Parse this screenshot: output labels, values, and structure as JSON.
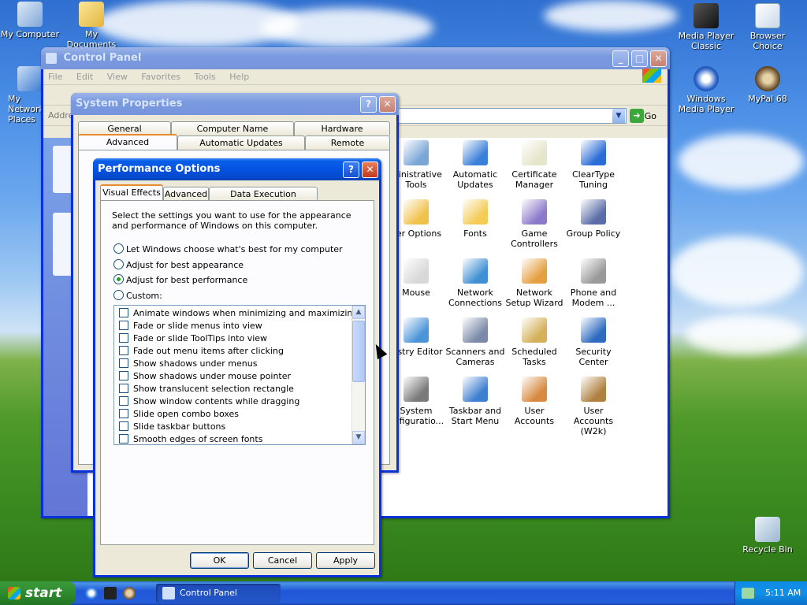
{
  "desktop": {
    "icons": [
      {
        "label": "My Computer"
      },
      {
        "label": "My Documents"
      },
      {
        "label": "My Network Places"
      },
      {
        "label": "Media Player Classic"
      },
      {
        "label": "Browser Choice"
      },
      {
        "label": "Windows Media Player"
      },
      {
        "label": "MyPal 68"
      },
      {
        "label": "Recycle Bin"
      }
    ]
  },
  "control_panel": {
    "title": "Control Panel",
    "menu": [
      "File",
      "Edit",
      "View",
      "Favorites",
      "Tools",
      "Help"
    ],
    "address_label": "Addre",
    "go_label": "Go",
    "items": [
      {
        "label": "ministrative Tools"
      },
      {
        "label": "Automatic Updates"
      },
      {
        "label": "Certificate Manager"
      },
      {
        "label": "ClearType Tuning"
      },
      {
        "label": "der Options"
      },
      {
        "label": "Fonts"
      },
      {
        "label": "Game Controllers"
      },
      {
        "label": "Group Policy"
      },
      {
        "label": "Mouse"
      },
      {
        "label": "Network Connections"
      },
      {
        "label": "Network Setup Wizard"
      },
      {
        "label": "Phone and Modem ..."
      },
      {
        "label": "gistry Editor"
      },
      {
        "label": "Scanners and Cameras"
      },
      {
        "label": "Scheduled Tasks"
      },
      {
        "label": "Security Center"
      },
      {
        "label": "System onfiguratio..."
      },
      {
        "label": "Taskbar and Start Menu"
      },
      {
        "label": "User Accounts"
      },
      {
        "label": "User Accounts (W2k)"
      }
    ]
  },
  "system_properties": {
    "title": "System Properties",
    "tabs_row1": [
      "General",
      "Computer Name",
      "Hardware"
    ],
    "tabs_row2": [
      "Advanced",
      "Automatic Updates",
      "Remote"
    ]
  },
  "performance_options": {
    "title": "Performance Options",
    "tabs": [
      "Visual Effects",
      "Advanced",
      "Data Execution Prevention"
    ],
    "description": "Select the settings you want to use for the appearance and performance of Windows on this computer.",
    "radios": [
      {
        "label": "Let Windows choose what's best for my computer",
        "checked": false
      },
      {
        "label": "Adjust for best appearance",
        "checked": false
      },
      {
        "label": "Adjust for best performance",
        "checked": true
      },
      {
        "label": "Custom:",
        "checked": false
      }
    ],
    "effects": [
      "Animate windows when minimizing and maximizing",
      "Fade or slide menus into view",
      "Fade or slide ToolTips into view",
      "Fade out menu items after clicking",
      "Show shadows under menus",
      "Show shadows under mouse pointer",
      "Show translucent selection rectangle",
      "Show window contents while dragging",
      "Slide open combo boxes",
      "Slide taskbar buttons",
      "Smooth edges of screen fonts"
    ],
    "buttons": {
      "ok": "OK",
      "cancel": "Cancel",
      "apply": "Apply"
    }
  },
  "taskbar": {
    "start_label": "start",
    "task_label": "Control Panel",
    "clock": "5:11 AM"
  }
}
